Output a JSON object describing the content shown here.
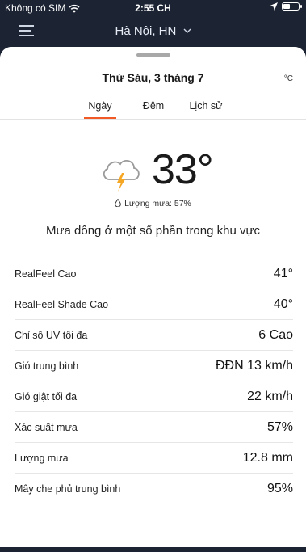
{
  "status_bar": {
    "carrier": "Không có SIM",
    "time": "2:55 CH"
  },
  "header": {
    "location": "Hà Nội, HN"
  },
  "sheet": {
    "date": "Thứ Sáu, 3 tháng 7",
    "unit": "°C",
    "tabs": [
      {
        "label": "Ngày",
        "active": true
      },
      {
        "label": "Đêm",
        "active": false
      },
      {
        "label": "Lịch sử",
        "active": false
      }
    ],
    "temperature": "33°",
    "precipitation": "Lượng mưa: 57%",
    "condition": "Mưa dông ở một số phần trong khu vực",
    "details": [
      {
        "label": "RealFeel Cao",
        "value": "41°"
      },
      {
        "label": "RealFeel Shade Cao",
        "value": "40°"
      },
      {
        "label": "Chỉ số UV tối đa",
        "value": "6 Cao"
      },
      {
        "label": "Gió trung bình",
        "value": "ĐĐN 13 km/h"
      },
      {
        "label": "Gió giật tối đa",
        "value": "22 km/h"
      },
      {
        "label": "Xác suất mưa",
        "value": "57%"
      },
      {
        "label": "Lượng mưa",
        "value": "12.8 mm"
      },
      {
        "label": "Mây che phủ trung bình",
        "value": "95%"
      }
    ]
  },
  "colors": {
    "accent": "#f15a24",
    "header_bg": "#1c2333",
    "lightning": "#f5a623"
  },
  "icons": [
    "wifi-icon",
    "location-arrow-icon",
    "battery-icon",
    "menu-icon",
    "chevron-down-icon",
    "thunderstorm-icon",
    "raindrop-icon"
  ]
}
